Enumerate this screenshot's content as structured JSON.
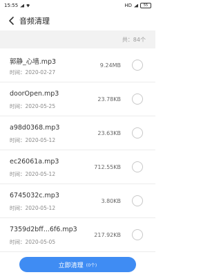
{
  "status_bar": {
    "time": "15:55",
    "network": "HD",
    "battery": "55"
  },
  "header": {
    "back_icon": "chevron-left-icon",
    "title": "音频清理"
  },
  "summary": {
    "count_text": "共：84个"
  },
  "files": [
    {
      "name": "郭静_心墙.mp3",
      "date": "时间：2020-02-27",
      "size": "9.24MB"
    },
    {
      "name": "doorOpen.mp3",
      "date": "时间：2020-05-25",
      "size": "23.78KB"
    },
    {
      "name": "a98d0368.mp3",
      "date": "时间：2020-05-12",
      "size": "23.63KB"
    },
    {
      "name": "ec26061a.mp3",
      "date": "时间：2020-05-12",
      "size": "712.55KB"
    },
    {
      "name": "6745032c.mp3",
      "date": "时间：2020-05-12",
      "size": "3.80KB"
    },
    {
      "name": "7359d2bff...6f6.mp3",
      "date": "时间：2020-05-05",
      "size": "217.92KB"
    }
  ],
  "action": {
    "label": "立即清理",
    "count": "(0个)"
  },
  "colors": {
    "accent": "#3f8cf3",
    "divider_bg": "#f2f2f2"
  }
}
